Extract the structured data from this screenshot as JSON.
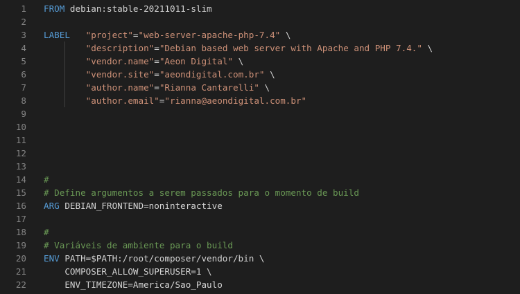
{
  "editor": {
    "lines": [
      {
        "num": "1",
        "segments": [
          {
            "t": "kw",
            "v": "FROM"
          },
          {
            "t": "plain",
            "v": " debian:stable-20211011-slim"
          }
        ]
      },
      {
        "num": "2",
        "segments": []
      },
      {
        "num": "3",
        "segments": [
          {
            "t": "kw",
            "v": "LABEL"
          },
          {
            "t": "plain",
            "v": "   "
          },
          {
            "t": "str",
            "v": "\"project\""
          },
          {
            "t": "plain",
            "v": "="
          },
          {
            "t": "str",
            "v": "\"web-server-apache-php-7.4\""
          },
          {
            "t": "plain",
            "v": " \\"
          }
        ]
      },
      {
        "num": "4",
        "segments": [
          {
            "t": "plain",
            "v": "        "
          },
          {
            "t": "str",
            "v": "\"description\""
          },
          {
            "t": "plain",
            "v": "="
          },
          {
            "t": "str",
            "v": "\"Debian based web server with Apache and PHP 7.4.\""
          },
          {
            "t": "plain",
            "v": " \\"
          }
        ]
      },
      {
        "num": "5",
        "segments": [
          {
            "t": "plain",
            "v": "        "
          },
          {
            "t": "str",
            "v": "\"vendor.name\""
          },
          {
            "t": "plain",
            "v": "="
          },
          {
            "t": "str",
            "v": "\"Aeon Digital\""
          },
          {
            "t": "plain",
            "v": " \\"
          }
        ]
      },
      {
        "num": "6",
        "segments": [
          {
            "t": "plain",
            "v": "        "
          },
          {
            "t": "str",
            "v": "\"vendor.site\""
          },
          {
            "t": "plain",
            "v": "="
          },
          {
            "t": "str",
            "v": "\"aeondigital.com.br\""
          },
          {
            "t": "plain",
            "v": " \\"
          }
        ]
      },
      {
        "num": "7",
        "segments": [
          {
            "t": "plain",
            "v": "        "
          },
          {
            "t": "str",
            "v": "\"author.name\""
          },
          {
            "t": "plain",
            "v": "="
          },
          {
            "t": "str",
            "v": "\"Rianna Cantarelli\""
          },
          {
            "t": "plain",
            "v": " \\"
          }
        ]
      },
      {
        "num": "8",
        "segments": [
          {
            "t": "plain",
            "v": "        "
          },
          {
            "t": "str",
            "v": "\"author.email\""
          },
          {
            "t": "plain",
            "v": "="
          },
          {
            "t": "str",
            "v": "\"rianna@aeondigital.com.br\""
          }
        ]
      },
      {
        "num": "9",
        "segments": []
      },
      {
        "num": "10",
        "segments": []
      },
      {
        "num": "11",
        "segments": []
      },
      {
        "num": "12",
        "segments": []
      },
      {
        "num": "13",
        "segments": []
      },
      {
        "num": "14",
        "segments": [
          {
            "t": "com",
            "v": "#"
          }
        ]
      },
      {
        "num": "15",
        "segments": [
          {
            "t": "com",
            "v": "# Define argumentos a serem passados para o momento de build"
          }
        ]
      },
      {
        "num": "16",
        "segments": [
          {
            "t": "kw",
            "v": "ARG"
          },
          {
            "t": "plain",
            "v": " DEBIAN_FRONTEND=noninteractive"
          }
        ]
      },
      {
        "num": "17",
        "segments": []
      },
      {
        "num": "18",
        "segments": [
          {
            "t": "com",
            "v": "#"
          }
        ]
      },
      {
        "num": "19",
        "segments": [
          {
            "t": "com",
            "v": "# Variáveis de ambiente para o build"
          }
        ]
      },
      {
        "num": "20",
        "segments": [
          {
            "t": "kw",
            "v": "ENV"
          },
          {
            "t": "plain",
            "v": " PATH=$PATH:/root/composer/vendor/bin \\"
          }
        ]
      },
      {
        "num": "21",
        "segments": [
          {
            "t": "plain",
            "v": "    COMPOSER_ALLOW_SUPERUSER=1 \\"
          }
        ]
      },
      {
        "num": "22",
        "segments": [
          {
            "t": "plain",
            "v": "    ENV_TIMEZONE=America/Sao_Paulo"
          }
        ]
      }
    ]
  },
  "colors": {
    "background": "#1e1e1e",
    "line_number": "#858585",
    "keyword": "#569cd6",
    "string": "#ce9178",
    "comment": "#6a9955",
    "text": "#d4d4d4"
  }
}
